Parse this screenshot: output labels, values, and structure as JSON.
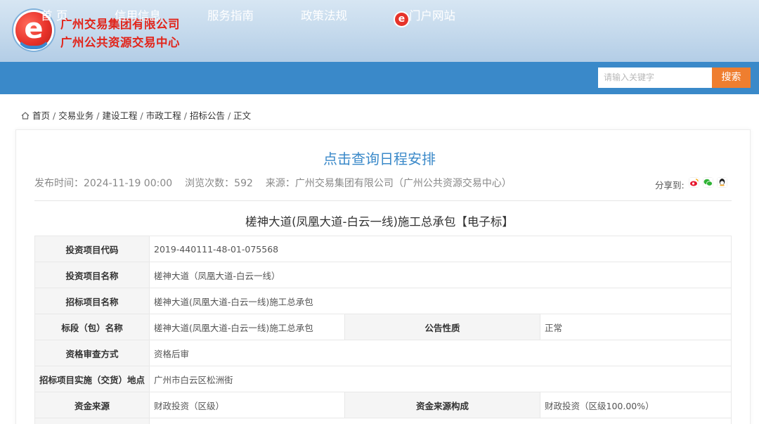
{
  "header": {
    "org_name_line1": "广州交易集团有限公司",
    "org_name_line2": "广州公共资源交易中心",
    "logo_letter": "e"
  },
  "nav": {
    "items": [
      {
        "label": "首 页"
      },
      {
        "label": "信用信息"
      },
      {
        "label": "服务指南"
      },
      {
        "label": "政策法规"
      },
      {
        "label": "门户网站"
      }
    ],
    "portal_icon_letter": "e",
    "search_placeholder": "请输入关键字",
    "search_button": "搜索"
  },
  "breadcrumb": [
    "首页",
    "交易业务",
    "建设工程",
    "市政工程",
    "招标公告",
    "正文"
  ],
  "article": {
    "schedule_link": "点击查询日程安排",
    "publish_time": "发布时间：2024-11-19 00:00",
    "views": "浏览次数：592",
    "source": "来源：广州交易集团有限公司（广州公共资源交易中心）",
    "share_label": "分享到:",
    "title": "槎神大道(凤凰大道-白云一线)施工总承包【电子标】"
  },
  "info_table": {
    "rows": [
      {
        "key": "投资项目代码",
        "value": "2019-440111-48-01-075568"
      },
      {
        "key": "投资项目名称",
        "value": "槎神大道（凤凰大道-白云一线）"
      },
      {
        "key": "招标项目名称",
        "value": "槎神大道(凤凰大道-白云一线)施工总承包"
      },
      {
        "key": "标段（包）名称",
        "value": "槎神大道(凤凰大道-白云一线)施工总承包",
        "key2": "公告性质",
        "value2": "正常"
      },
      {
        "key": "资格审查方式",
        "value": "资格后审"
      },
      {
        "key": "招标项目实施（交货）地点",
        "value": "广州市白云区松洲街"
      },
      {
        "key": "资金来源",
        "value": "财政投资（区级）",
        "key2": "资金来源构成",
        "value2": "财政投资（区级100.00%）"
      }
    ]
  },
  "colors": {
    "nav_bg": "#3a89c9",
    "accent_orange": "#ef7e2f",
    "brand_red": "#e1251b",
    "link_blue": "#3a89c9"
  }
}
